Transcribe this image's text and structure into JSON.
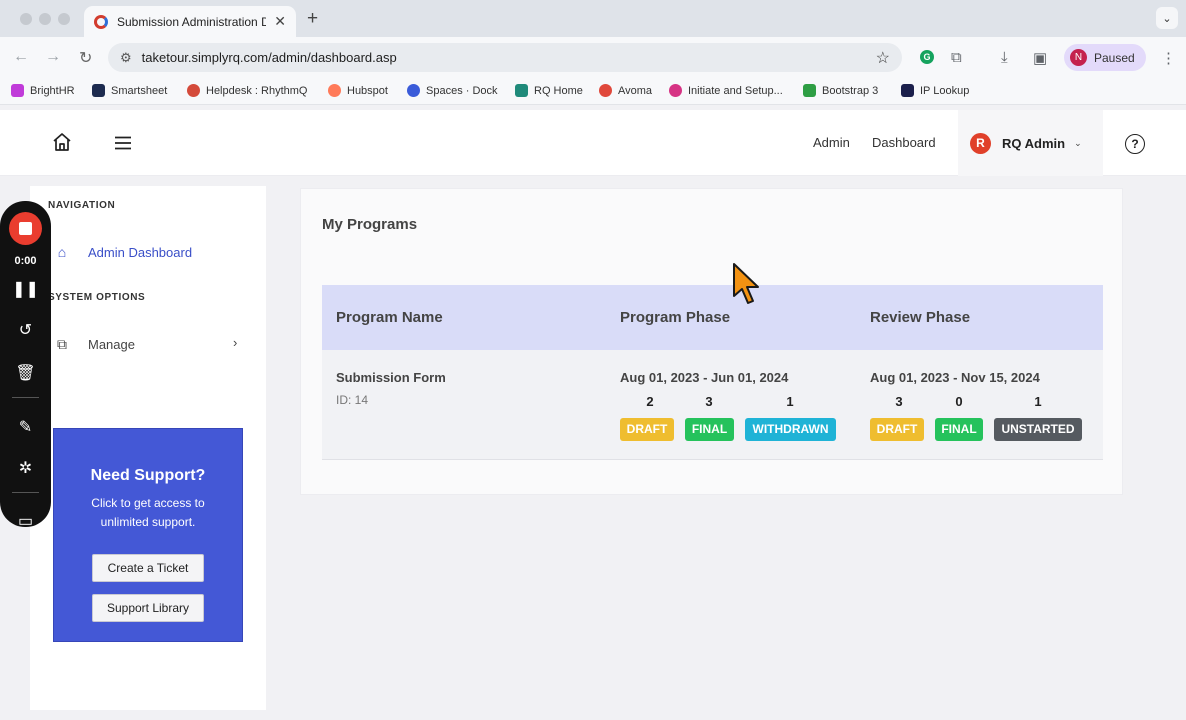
{
  "browser": {
    "tab_title": "Submission Administration Da",
    "url": "taketour.simplyrq.com/admin/dashboard.asp",
    "profile_initial": "N",
    "profile_status": "Paused",
    "bookmarks": [
      {
        "label": "BrightHR",
        "color": "#c03bd9"
      },
      {
        "label": "Smartsheet",
        "color": "#1d2b4f"
      },
      {
        "label": "Helpdesk : RhythmQ",
        "color": "#d44a3a"
      },
      {
        "label": "Hubspot",
        "color": "#ff7a59"
      },
      {
        "label": "Spaces · Dock",
        "color": "#3a5bd9"
      },
      {
        "label": "RQ Home",
        "color": "#1f8a7a"
      },
      {
        "label": "Avoma",
        "color": "#e0483b"
      },
      {
        "label": "Initiate and Setup...",
        "color": "#d63384"
      },
      {
        "label": "Bootstrap 3",
        "color": "#2e9e44"
      },
      {
        "label": "IP Lookup",
        "color": "#1b1f4b"
      }
    ]
  },
  "header": {
    "admin_link": "Admin",
    "dashboard_link": "Dashboard",
    "user_initial": "R",
    "user_name": "RQ Admin"
  },
  "sidebar": {
    "nav_heading": "NAVIGATION",
    "admin_dashboard": "Admin Dashboard",
    "system_heading": "SYSTEM OPTIONS",
    "manage": "Manage"
  },
  "support": {
    "title": "Need Support?",
    "text": "Click to get access to unlimited support.",
    "create_ticket": "Create a Ticket",
    "support_library": "Support Library"
  },
  "recorder": {
    "time": "0:00"
  },
  "programs": {
    "title": "My Programs",
    "col_name": "Program Name",
    "col_program_phase": "Program Phase",
    "col_review_phase": "Review Phase",
    "row": {
      "name": "Submission Form",
      "id": "ID: 14",
      "program_dates": "Aug 01, 2023 - Jun 01, 2024",
      "program_counts": [
        "2",
        "3",
        "1"
      ],
      "program_badges": [
        "DRAFT",
        "FINAL",
        "WITHDRAWN"
      ],
      "review_dates": "Aug 01, 2023 - Nov 15, 2024",
      "review_counts": [
        "3",
        "0",
        "1"
      ],
      "review_badges": [
        "DRAFT",
        "FINAL",
        "UNSTARTED"
      ]
    }
  },
  "colors": {
    "accent": "#4458d6",
    "draft": "#efbd2f",
    "final": "#25c25c",
    "withdrawn": "#1fb3d6",
    "unstarted": "#555a60",
    "table_header": "#d9dcf8"
  }
}
